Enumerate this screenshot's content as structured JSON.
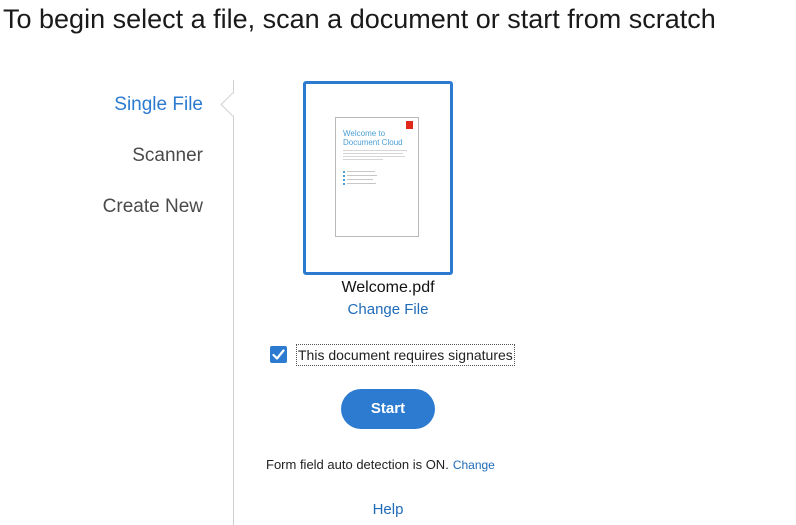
{
  "header": {
    "title": "To begin select a file, scan a document or start from scratch"
  },
  "sidebar": {
    "items": [
      {
        "label": "Single File",
        "active": true
      },
      {
        "label": "Scanner",
        "active": false
      },
      {
        "label": "Create New",
        "active": false
      }
    ]
  },
  "file": {
    "thumbnail_title": "Welcome to Document Cloud",
    "name": "Welcome.pdf",
    "change_label": "Change File"
  },
  "signature": {
    "checked": true,
    "label": "This document requires signatures"
  },
  "actions": {
    "start_label": "Start"
  },
  "auto_detection": {
    "text": "Form field auto detection is ON.",
    "change_label": "Change"
  },
  "footer": {
    "help_label": "Help"
  },
  "colors": {
    "accent": "#2c7bd0",
    "link": "#1f6bb8",
    "pdf_red": "#e0281b"
  }
}
